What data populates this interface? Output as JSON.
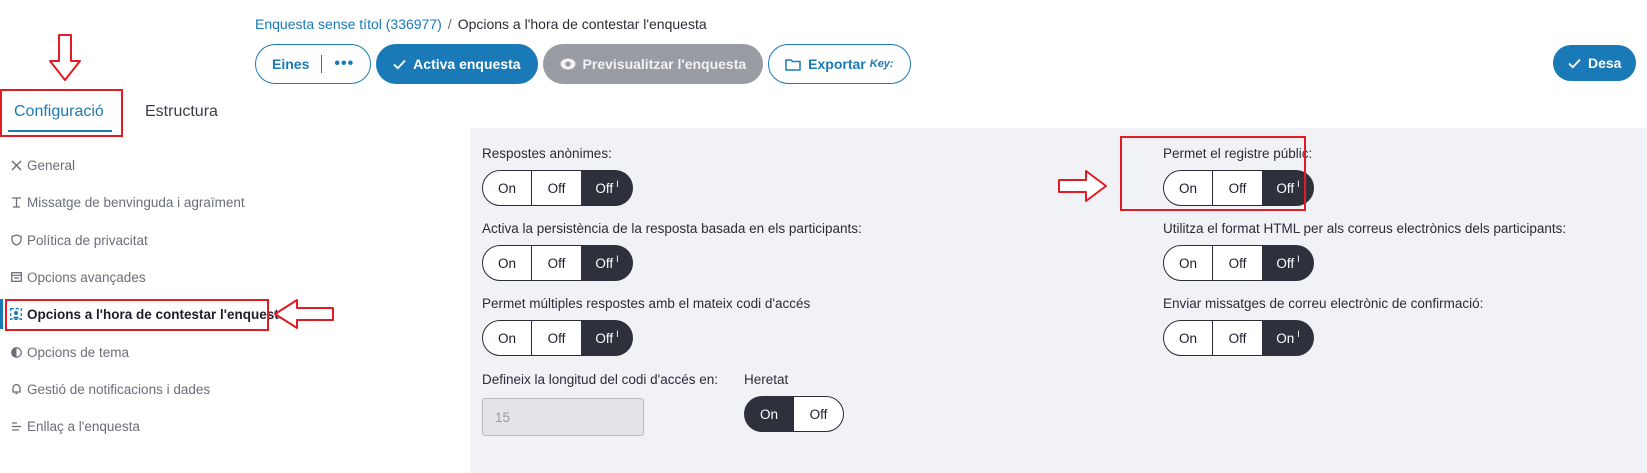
{
  "breadcrumb": {
    "survey": "Enquesta sense títol (336977)",
    "separator": "/",
    "current": "Opcions a l'hora de contestar l'enquesta"
  },
  "toolbar": {
    "tools_label": "Eines",
    "tools_more": "•••",
    "activate_label": "Activa enquesta",
    "preview_label": "Previsualitzar l'enquesta",
    "export_label": "Exportar",
    "export_key": "Key:",
    "save_label": "Desa"
  },
  "tabs": [
    {
      "label": "Configuració",
      "active": true
    },
    {
      "label": "Estructura",
      "active": false
    }
  ],
  "sidebar": {
    "items": [
      {
        "label": "General",
        "icon": "tools-icon"
      },
      {
        "label": "Missatge de benvinguda i agraïment",
        "icon": "text-icon"
      },
      {
        "label": "Política de privacitat",
        "icon": "shield-icon"
      },
      {
        "label": "Opcions avançades",
        "icon": "window-icon"
      },
      {
        "label": "Opcions a l'hora de contestar l'enquesta",
        "icon": "participant-icon",
        "active": true
      },
      {
        "label": "Opcions de tema",
        "icon": "contrast-icon"
      },
      {
        "label": "Gestió de notificacions i dades",
        "icon": "bell-icon"
      },
      {
        "label": "Enllaç a l'enquesta",
        "icon": "list-icon"
      }
    ]
  },
  "settings": {
    "anonymous": {
      "label": "Respostes anònimes:",
      "on": "On",
      "off": "Off",
      "inherit": "Off",
      "inherit_mark": "I",
      "selected": "inherit"
    },
    "persistence": {
      "label": "Activa la persistència de la resposta basada en els participants:",
      "on": "On",
      "off": "Off",
      "inherit": "Off",
      "inherit_mark": "I",
      "selected": "inherit"
    },
    "multiple": {
      "label": "Permet múltiples respostes amb el mateix codi d'accés",
      "on": "On",
      "off": "Off",
      "inherit": "Off",
      "inherit_mark": "I",
      "selected": "inherit"
    },
    "code_length": {
      "label": "Defineix la longitud del codi d'accés en:",
      "value": "15"
    },
    "inherited": {
      "label": "Heretat",
      "on": "On",
      "off": "Off",
      "selected": "on"
    },
    "public_registration": {
      "label": "Permet el registre públic:",
      "on": "On",
      "off": "Off",
      "inherit": "Off",
      "inherit_mark": "I",
      "selected": "inherit"
    },
    "html_email": {
      "label": "Utilitza el format HTML per als correus electrònics dels participants:",
      "on": "On",
      "off": "Off",
      "inherit": "Off",
      "inherit_mark": "I",
      "selected": "inherit"
    },
    "confirmation_email": {
      "label": "Enviar missatges de correu electrònic de confirmació:",
      "on": "On",
      "off": "Off",
      "inherit": "On",
      "inherit_mark": "I",
      "selected": "inherit"
    }
  },
  "colors": {
    "accent": "#1a7ab8",
    "selected_toggle": "#2e303b",
    "annotation": "#e21b24",
    "panel_bg": "#f1f2f6"
  }
}
